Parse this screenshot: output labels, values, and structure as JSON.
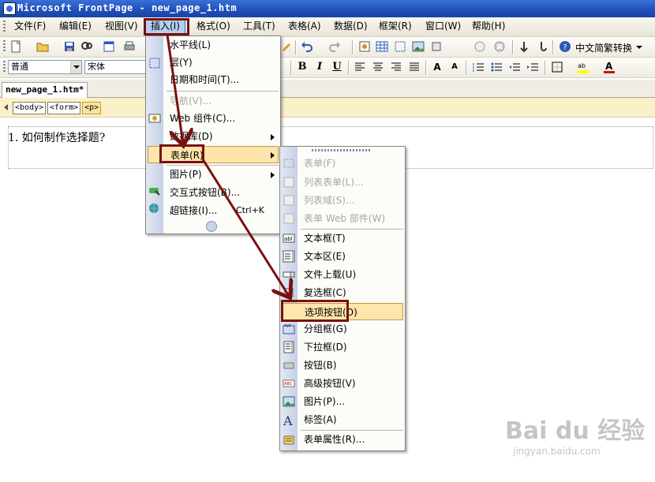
{
  "window": {
    "title": "Microsoft FrontPage - new_page_1.htm"
  },
  "menubar": {
    "items": [
      "文件(F)",
      "编辑(E)",
      "视图(V)",
      "插入(I)",
      "格式(O)",
      "工具(T)",
      "表格(A)",
      "数据(D)",
      "框架(R)",
      "窗口(W)",
      "帮助(H)"
    ]
  },
  "toolbar_standard": {
    "language_label": "中文简繁转换"
  },
  "toolbar_format": {
    "style_value": "普通",
    "font_value": "宋体"
  },
  "tabs": {
    "active": "new_page_1.htm*"
  },
  "tagbar": {
    "tags": [
      "<body>",
      "<form>",
      "<p>"
    ]
  },
  "editor": {
    "text": "1. 如何制作选择题?"
  },
  "insert_menu": {
    "items": [
      {
        "label": "水平线(L)"
      },
      {
        "label": "层(Y)"
      },
      {
        "label": "日期和时间(T)..."
      },
      {
        "label": "导航(V)..."
      },
      {
        "label": "Web 组件(C)..."
      },
      {
        "label": "数据库(D)"
      },
      {
        "label": "表单(R)"
      },
      {
        "label": "图片(P)"
      },
      {
        "label": "交互式按钮(B)..."
      },
      {
        "label": "超链接(I)...",
        "shortcut": "Ctrl+K"
      }
    ]
  },
  "form_submenu": {
    "items": [
      {
        "label": "表单(F)"
      },
      {
        "label": "列表表单(L)..."
      },
      {
        "label": "列表域(S)..."
      },
      {
        "label": "表单 Web 部件(W)"
      },
      {
        "label": "文本框(T)"
      },
      {
        "label": "文本区(E)"
      },
      {
        "label": "文件上载(U)"
      },
      {
        "label": "复选框(C)"
      },
      {
        "label": "选项按钮(O)"
      },
      {
        "label": "分组框(G)"
      },
      {
        "label": "下拉框(D)"
      },
      {
        "label": "按钮(B)"
      },
      {
        "label": "高级按钮(V)"
      },
      {
        "label": "图片(P)..."
      },
      {
        "label": "标签(A)"
      },
      {
        "label": "表单属性(R)..."
      }
    ]
  },
  "watermark": {
    "brand": "Bai du 经验",
    "url": "jingyan.baidu.com"
  },
  "colors": {
    "titlebar": "#1f4fb8",
    "annotation": "#7a1010",
    "highlight": "#fde5ab"
  }
}
